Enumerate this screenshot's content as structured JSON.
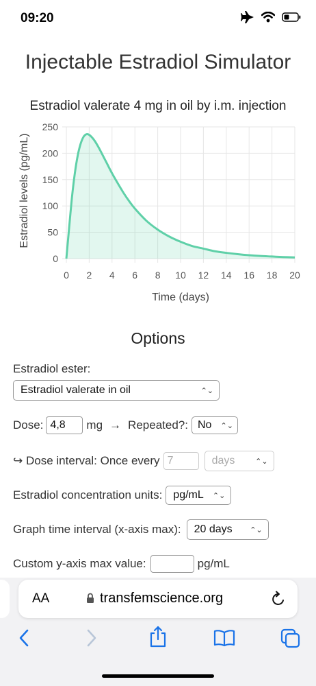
{
  "status": {
    "time": "09:20"
  },
  "page": {
    "title": "Injectable Estradiol Simulator"
  },
  "chart": {
    "title": "Estradiol valerate 4 mg in oil by i.m. injection"
  },
  "chart_data": {
    "type": "area",
    "title": "Estradiol valerate 4 mg in oil by i.m. injection",
    "xlabel": "Time (days)",
    "ylabel": "Estradiol levels (pg/mL)",
    "xlim": [
      0,
      20
    ],
    "ylim": [
      0,
      250
    ],
    "xticks": [
      0,
      2,
      4,
      6,
      8,
      10,
      12,
      14,
      16,
      18,
      20
    ],
    "yticks": [
      0,
      50,
      100,
      150,
      200,
      250
    ],
    "grid": true,
    "color": "#5fd0a8",
    "x": [
      0,
      0.25,
      0.5,
      0.75,
      1,
      1.25,
      1.5,
      1.75,
      2,
      2.25,
      2.5,
      2.75,
      3,
      3.5,
      4,
      4.5,
      5,
      5.5,
      6,
      7,
      8,
      9,
      10,
      11,
      12,
      13,
      14,
      15,
      16,
      17,
      18,
      19,
      20
    ],
    "y": [
      0,
      60,
      118,
      163,
      196,
      218,
      231,
      236,
      235,
      230,
      223,
      214,
      204,
      183,
      162,
      143,
      125,
      109,
      95,
      72,
      55,
      42,
      32,
      24,
      19,
      14,
      11,
      8.5,
      6.5,
      5,
      4,
      3,
      2.3
    ]
  },
  "options": {
    "title": "Options",
    "ester_label": "Estradiol ester:",
    "ester_value": "Estradiol valerate in oil",
    "dose_label": "Dose:",
    "dose_value": "4,8",
    "dose_unit": "mg",
    "arrow": "→",
    "repeated_label": "Repeated?:",
    "repeated_value": "No",
    "interval_prefix": "↪ Dose interval: Once every",
    "interval_value": "7",
    "interval_unit": "days",
    "units_label": "Estradiol concentration units:",
    "units_value": "pg/mL",
    "graph_interval_label": "Graph time interval (x-axis max):",
    "graph_interval_value": "20 days",
    "ymax_label": "Custom y-axis max value:",
    "ymax_value": "",
    "ymax_unit": "pg/mL"
  },
  "browser": {
    "aa": "AA",
    "url": "transfemscience.org"
  }
}
